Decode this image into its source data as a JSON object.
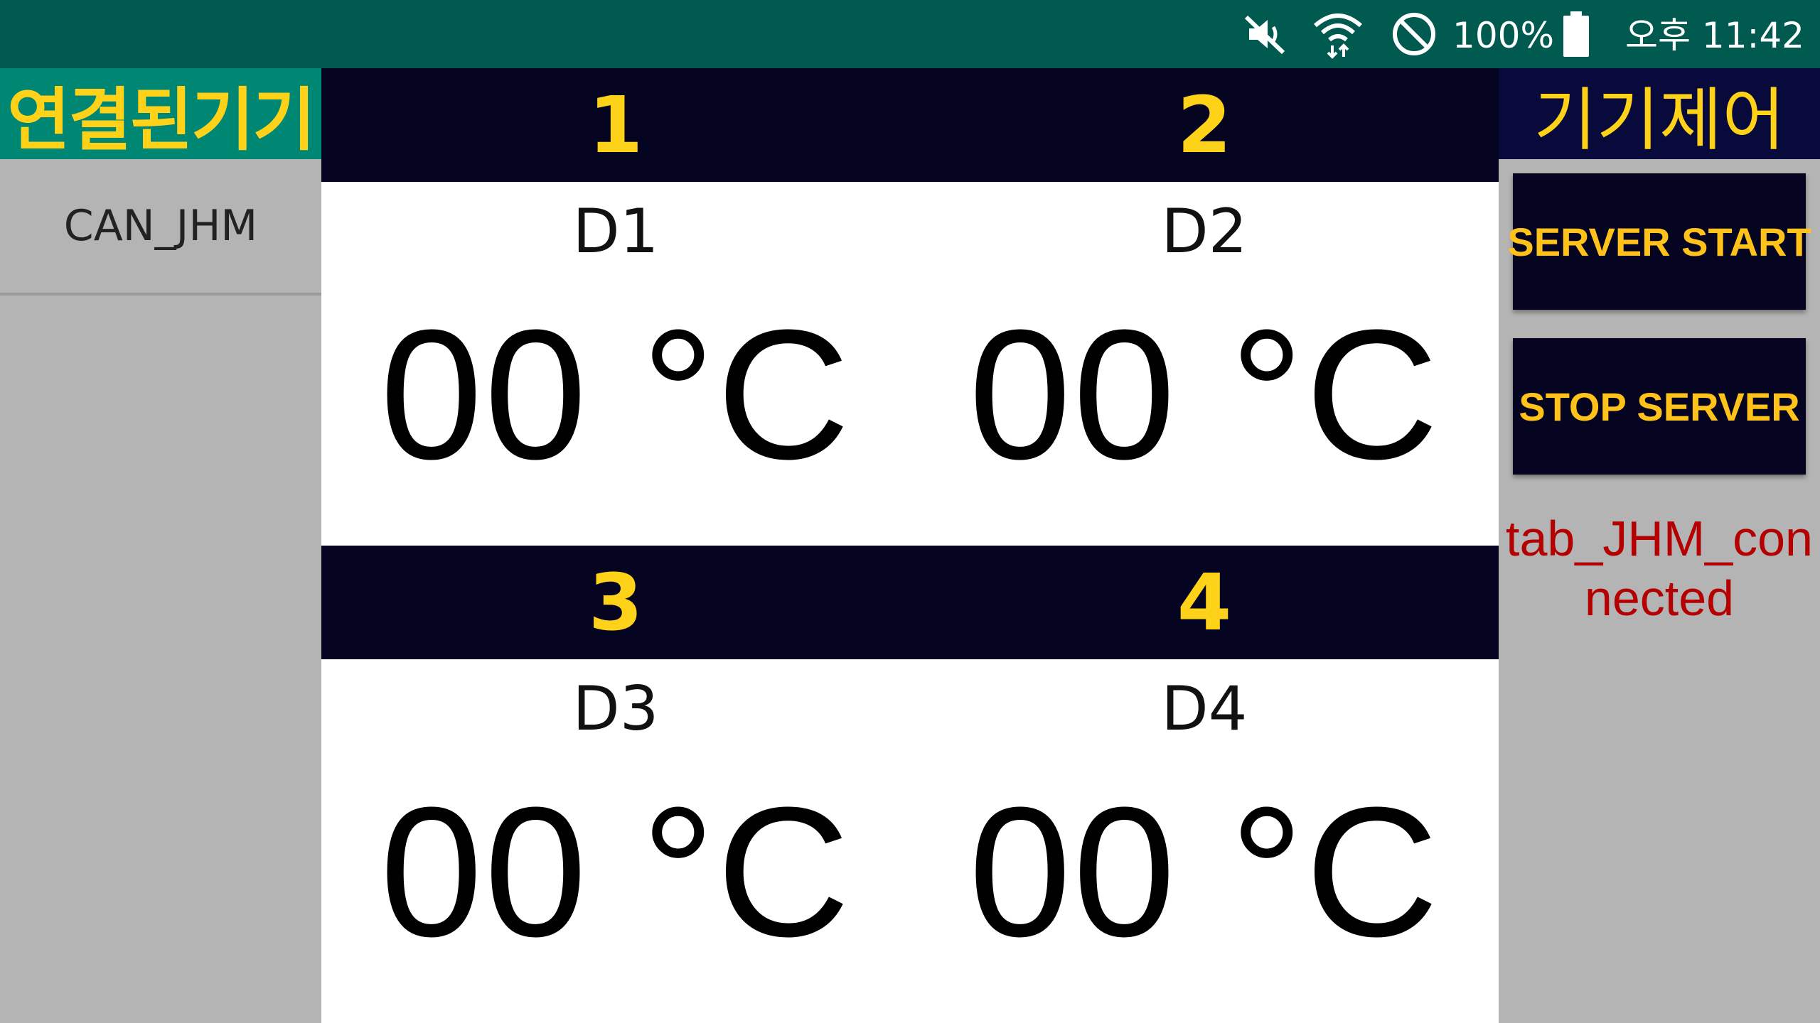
{
  "status_bar": {
    "battery_percent": "100%",
    "battery_level": 1.0,
    "time": "오후 11:42",
    "icons": [
      "mute-icon",
      "wifi-icon",
      "do-not-disturb-icon",
      "battery-icon"
    ],
    "background_color": "#005a4f"
  },
  "left_panel": {
    "title": "연결된기기",
    "devices": [
      {
        "name": "CAN_JHM"
      }
    ]
  },
  "sensors": [
    {
      "number": "1",
      "label": "D1",
      "temperature": "00 °C"
    },
    {
      "number": "2",
      "label": "D2",
      "temperature": "00 °C"
    },
    {
      "number": "3",
      "label": "D3",
      "temperature": "00 °C"
    },
    {
      "number": "4",
      "label": "D4",
      "temperature": "00 °C"
    }
  ],
  "right_panel": {
    "title": "기기제어",
    "start_button": "SERVER START",
    "stop_button": "STOP SERVER",
    "status_message": "tab_JHM_connected"
  },
  "colors": {
    "accent_yellow": "#ffd21a",
    "header_dark": "#050522",
    "left_header_green": "#008774",
    "status_red": "#b40000"
  }
}
